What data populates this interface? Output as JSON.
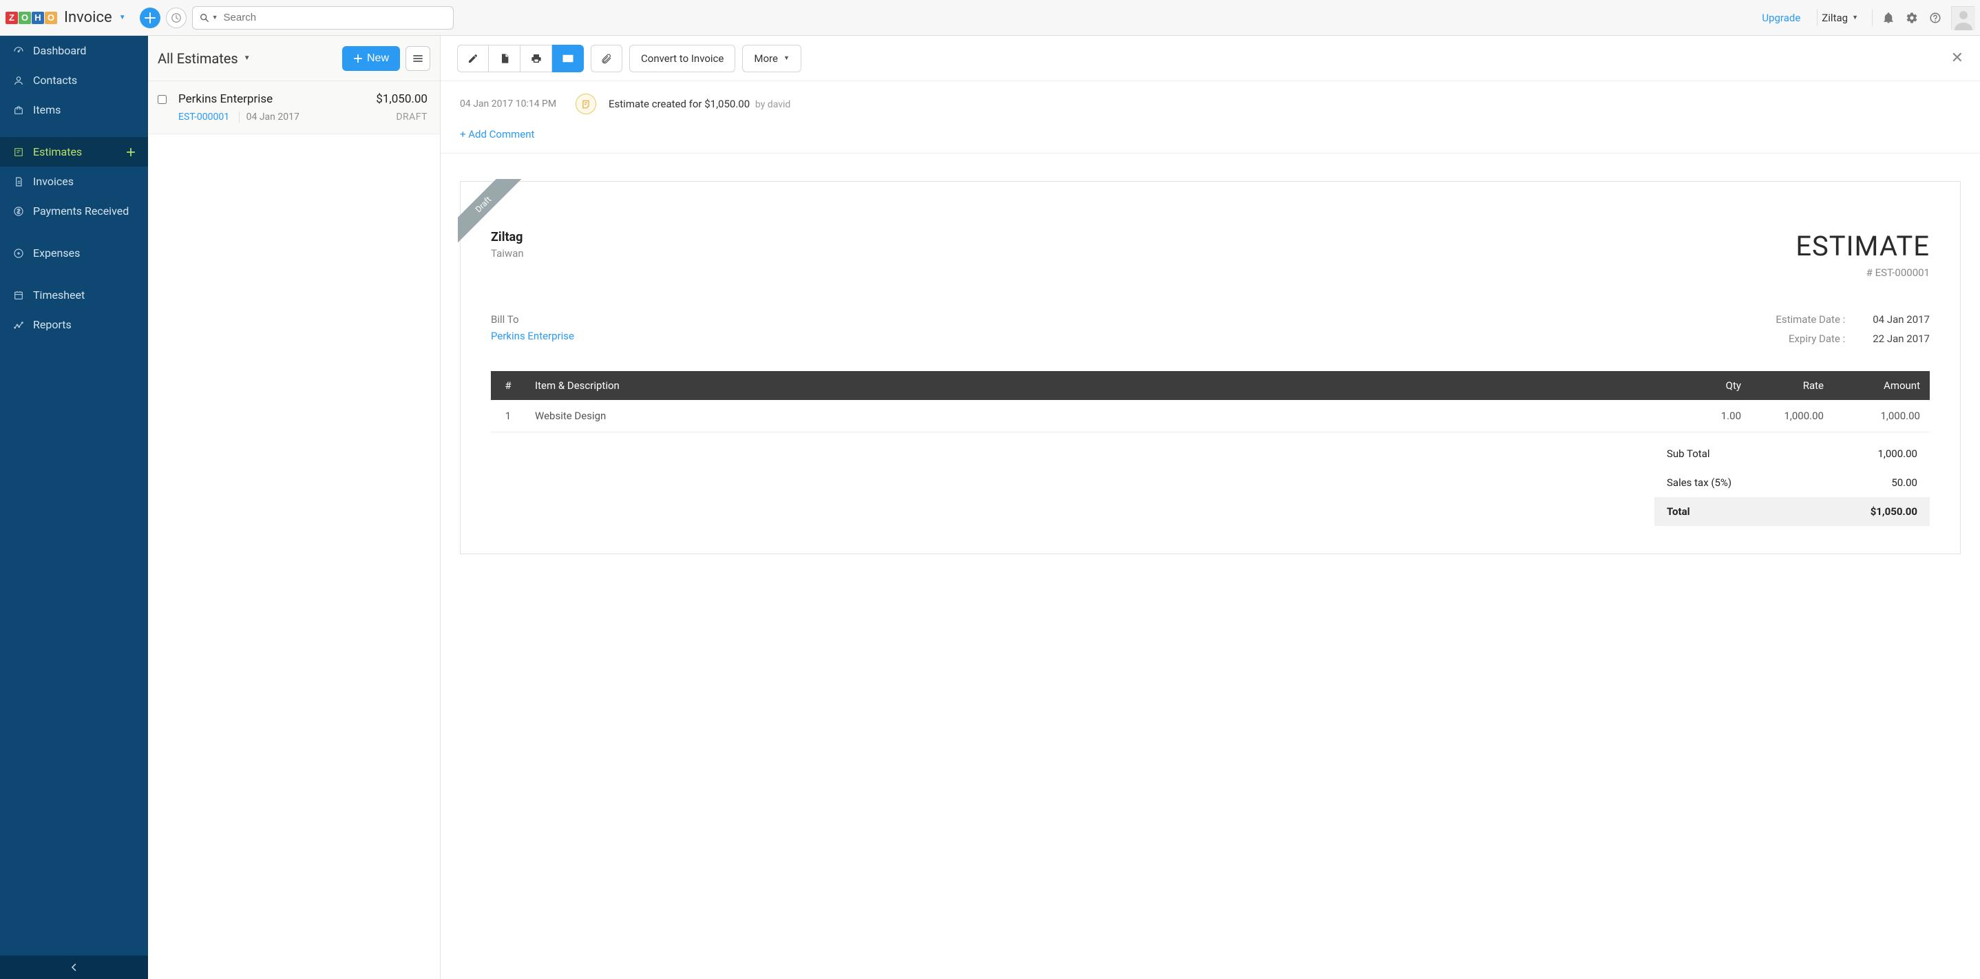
{
  "brand": {
    "product": "Invoice"
  },
  "topbar": {
    "search_placeholder": "Search",
    "upgrade": "Upgrade",
    "org_name": "Ziltag"
  },
  "sidebar": {
    "items": [
      {
        "label": "Dashboard"
      },
      {
        "label": "Contacts"
      },
      {
        "label": "Items"
      },
      {
        "label": "Estimates"
      },
      {
        "label": "Invoices"
      },
      {
        "label": "Payments Received"
      },
      {
        "label": "Expenses"
      },
      {
        "label": "Timesheet"
      },
      {
        "label": "Reports"
      }
    ]
  },
  "listpanel": {
    "title": "All Estimates",
    "new_label": "New",
    "rows": [
      {
        "customer": "Perkins Enterprise",
        "amount": "$1,050.00",
        "number": "EST-000001",
        "date": "04 Jan 2017",
        "status": "DRAFT"
      }
    ]
  },
  "toolbar": {
    "convert": "Convert to Invoice",
    "more": "More"
  },
  "activity": {
    "timestamp": "04 Jan 2017 10:14 PM",
    "text": "Estimate created for $1,050.00",
    "by_prefix": "by ",
    "by_user": "david",
    "add_comment": "+ Add Comment"
  },
  "doc": {
    "ribbon": "Draft",
    "company_name": "Ziltag",
    "company_loc": "Taiwan",
    "title": "ESTIMATE",
    "number": "# EST-000001",
    "bill_to_label": "Bill To",
    "bill_to_name": "Perkins Enterprise",
    "dates": {
      "estimate_label": "Estimate Date :",
      "estimate_value": "04 Jan 2017",
      "expiry_label": "Expiry Date :",
      "expiry_value": "22 Jan 2017"
    },
    "columns": {
      "num": "#",
      "item": "Item & Description",
      "qty": "Qty",
      "rate": "Rate",
      "amount": "Amount"
    },
    "line_items": [
      {
        "num": "1",
        "desc": "Website Design",
        "qty": "1.00",
        "rate": "1,000.00",
        "amount": "1,000.00"
      }
    ],
    "totals": {
      "subtotal_label": "Sub Total",
      "subtotal_value": "1,000.00",
      "tax_label": "Sales tax (5%)",
      "tax_value": "50.00",
      "total_label": "Total",
      "total_value": "$1,050.00"
    }
  }
}
